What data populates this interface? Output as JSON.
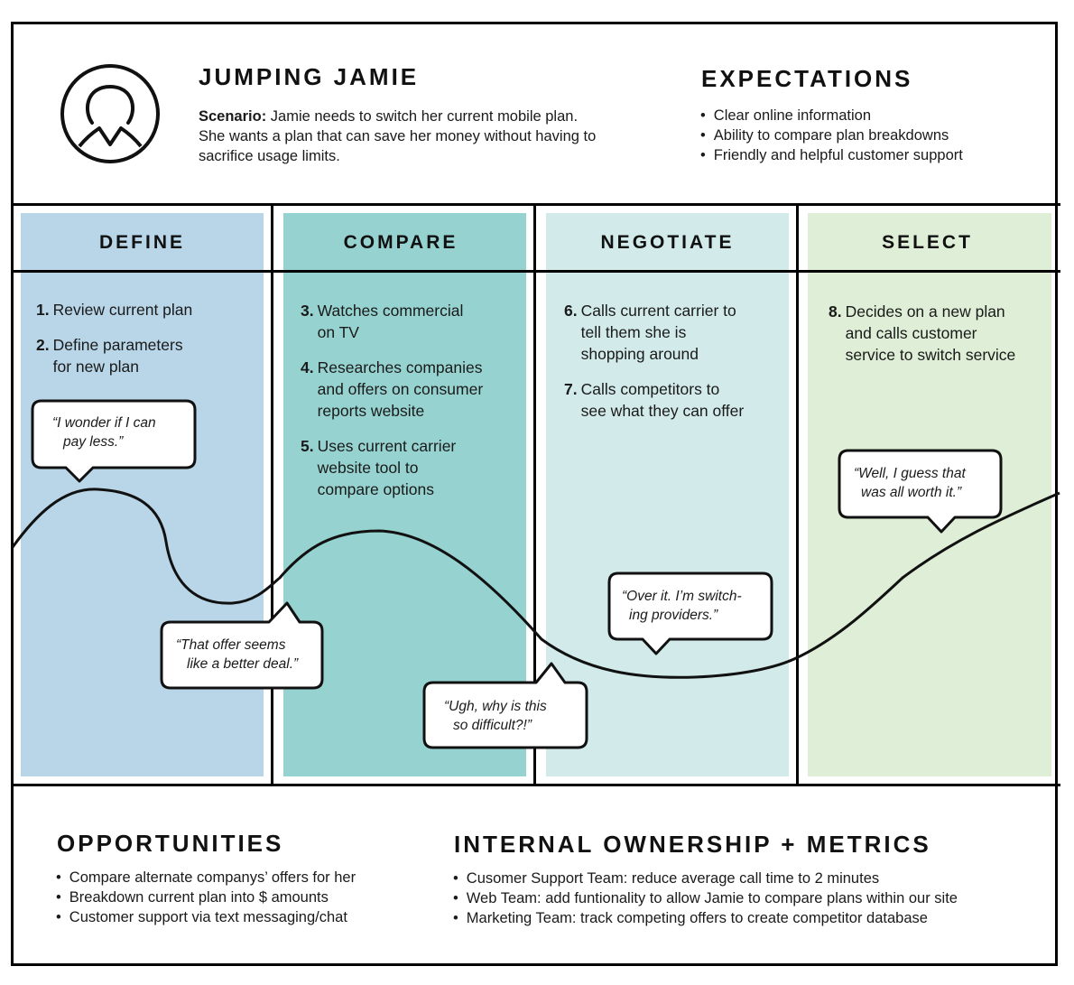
{
  "persona": {
    "icon": "user-avatar-icon",
    "name": "JUMPING JAMIE",
    "scenario_label": "Scenario:",
    "scenario_lines": [
      " Jamie needs to switch her current mobile plan.",
      "She wants a plan that can save her money without having to",
      "sacrifice usage limits."
    ]
  },
  "expectations": {
    "title": "EXPECTATIONS",
    "items": [
      "Clear online information",
      "Ability to compare plan breakdowns",
      "Friendly and helpful customer support"
    ]
  },
  "stages": [
    {
      "title": "DEFINE",
      "color": "#b8d6e8",
      "steps": [
        {
          "num": "1.",
          "lines": [
            "Review current plan"
          ]
        },
        {
          "num": "2.",
          "lines": [
            "Define parameters",
            "for new plan"
          ]
        }
      ]
    },
    {
      "title": "COMPARE",
      "color": "#96d3d0",
      "steps": [
        {
          "num": "3.",
          "lines": [
            "Watches commercial",
            "on TV"
          ]
        },
        {
          "num": "4.",
          "lines": [
            "Researches companies",
            "and offers on consumer",
            "reports website"
          ]
        },
        {
          "num": "5.",
          "lines": [
            "Uses current carrier",
            "website tool to",
            "compare options"
          ]
        }
      ]
    },
    {
      "title": "NEGOTIATE",
      "color": "#d2ebea",
      "steps": [
        {
          "num": "6.",
          "lines": [
            "Calls current carrier to",
            "tell them she is",
            "shopping around"
          ]
        },
        {
          "num": "7.",
          "lines": [
            "Calls competitors to",
            "see what they can offer"
          ]
        }
      ]
    },
    {
      "title": "SELECT",
      "color": "#dfeed6",
      "steps": [
        {
          "num": "8.",
          "lines": [
            "Decides on a new plan",
            "and calls customer",
            "service to switch service"
          ]
        }
      ]
    }
  ],
  "quotes": [
    {
      "lines": [
        "“I wonder if I can",
        "pay less.”"
      ]
    },
    {
      "lines": [
        "“That offer seems",
        "like a better deal.”"
      ]
    },
    {
      "lines": [
        "“Ugh, why is this",
        "so difficult?!”"
      ]
    },
    {
      "lines": [
        "“Over it. I’m switch-",
        "ing providers.”"
      ]
    },
    {
      "lines": [
        "“Well, I guess that",
        "was all worth it.”"
      ]
    }
  ],
  "emotion_curve": {
    "label": "emotional journey line",
    "trend": [
      "high",
      "low",
      "medium-high",
      "lowest",
      "high"
    ]
  },
  "opportunities": {
    "title": "OPPORTUNITIES",
    "items": [
      "Compare alternate companys’ offers for her",
      "Breakdown current plan into $ amounts",
      "Customer support via text messaging/chat"
    ]
  },
  "ownership": {
    "title": "INTERNAL OWNERSHIP + METRICS",
    "items": [
      "Cusomer Support Team: reduce average call time to 2 minutes",
      "Web Team: add funtionality to allow Jamie to compare plans within our site",
      "Marketing Team: track competing offers to create competitor database"
    ]
  }
}
